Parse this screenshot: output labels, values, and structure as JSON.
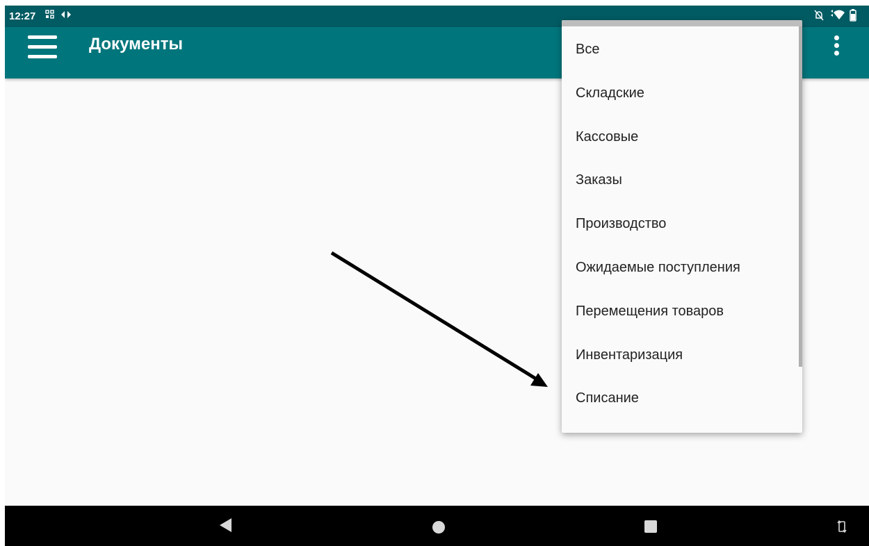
{
  "status_bar": {
    "time": "12:27"
  },
  "app_bar": {
    "title": "Документы",
    "menu_icon": "hamburger-menu-icon",
    "overflow_icon": "more-vert-icon"
  },
  "dropdown": {
    "items": [
      {
        "label": "Все"
      },
      {
        "label": "Складские"
      },
      {
        "label": "Кассовые"
      },
      {
        "label": "Заказы"
      },
      {
        "label": "Производство"
      },
      {
        "label": "Ожидаемые поступления"
      },
      {
        "label": "Перемещения товаров"
      },
      {
        "label": "Инвентаризация"
      },
      {
        "label": "Списание"
      }
    ]
  },
  "navigation_bar": {
    "back_icon": "back-triangle-icon",
    "home_icon": "home-circle-icon",
    "recents_icon": "recents-square-icon",
    "rotate_icon": "rotate-icon"
  },
  "colors": {
    "status_bar": "#005b63",
    "app_bar": "#00767c",
    "background": "#fafafa",
    "menu_text": "#222222",
    "nav_bar": "#000000"
  }
}
